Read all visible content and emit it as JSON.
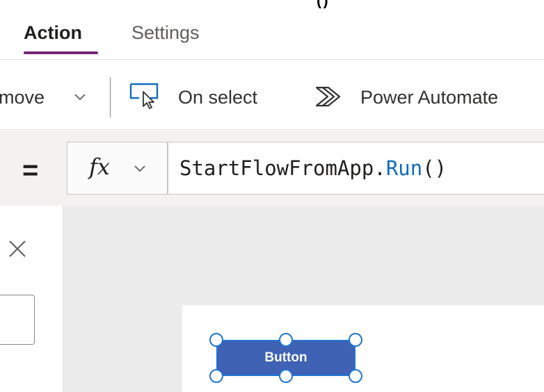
{
  "window": {
    "top_clipped_text": "()"
  },
  "tabs": [
    {
      "label": "Action",
      "active": true
    },
    {
      "label": "Settings",
      "active": false
    }
  ],
  "toolbar": {
    "remove_label": "move",
    "on_select_label": "On select",
    "power_automate_label": "Power Automate"
  },
  "formula_bar": {
    "equals_label": "=",
    "fx_label": "fx",
    "formula_object": "StartFlowFromApp.",
    "formula_method": "Run",
    "formula_args": "()"
  },
  "canvas": {
    "button_label": "Button"
  },
  "colors": {
    "tab_underline": "#742774",
    "button_fill": "#3f62b4",
    "selection": "#1f74d4",
    "formula_keyword": "#0f6cbd",
    "on_select_icon": "#0f6cbd"
  },
  "icons": {
    "remove_chevron": "chevron-down-icon",
    "on_select": "cursor-select-icon",
    "power_automate": "power-automate-icon",
    "fx_chevron": "chevron-down-icon",
    "close": "close-icon"
  }
}
